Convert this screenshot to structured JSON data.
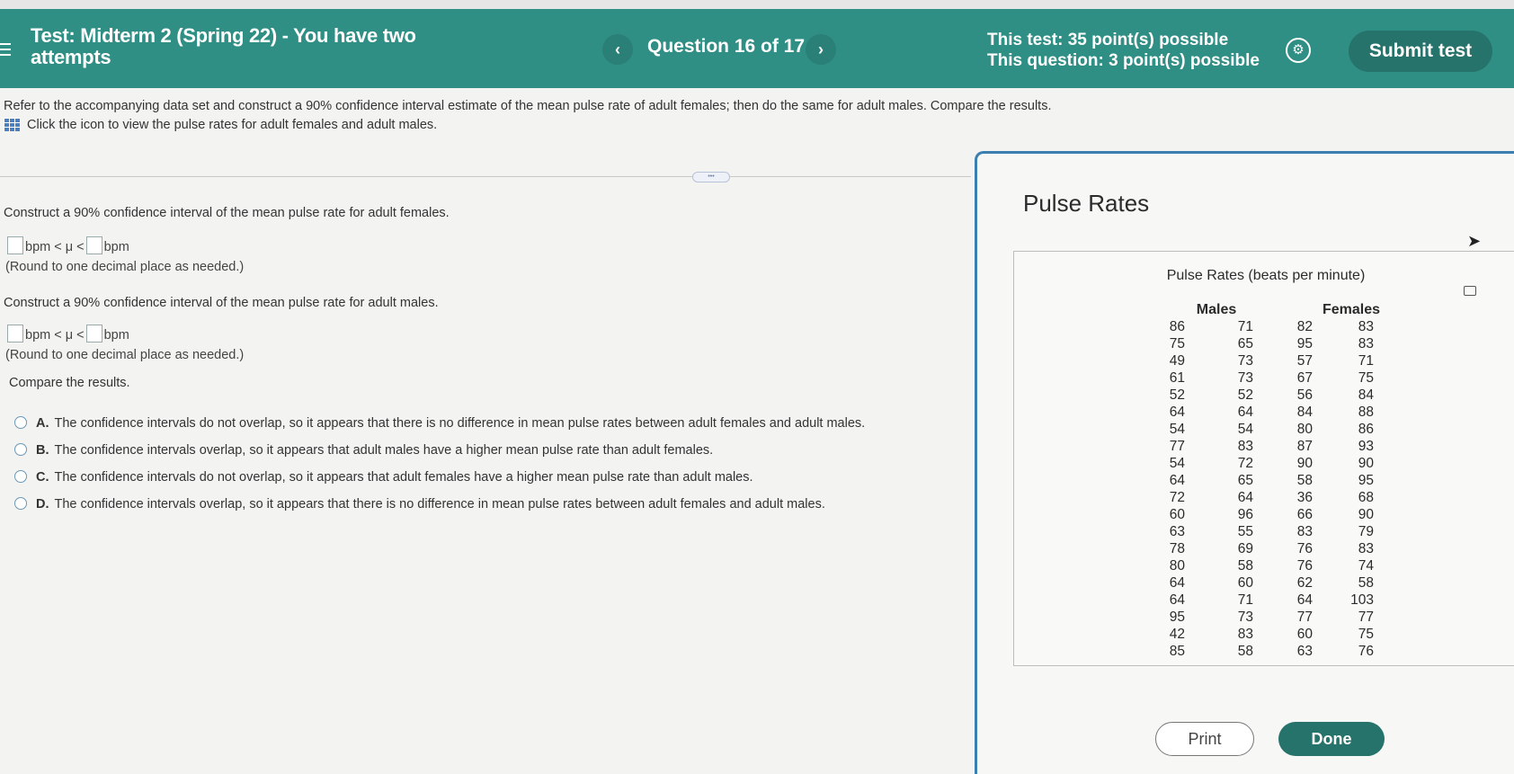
{
  "header": {
    "title": "Test: Midterm 2 (Spring 22) - You have two attempts",
    "question_counter": "Question 16 of 17",
    "prev_symbol": "‹",
    "next_symbol": "›",
    "test_points": "This test: 35 point(s) possible",
    "question_points": "This question: 3 point(s) possible",
    "submit_label": "Submit test"
  },
  "question": {
    "prompt": "Refer to the accompanying data set and construct a 90% confidence interval estimate of the mean pulse rate of adult females; then do the same for adult males. Compare the results.",
    "dataset_link": "Click the icon to view the pulse rates for adult females and adult males.",
    "part1": "Construct a 90% confidence interval of the mean pulse rate for adult females.",
    "part2": "Construct a 90% confidence interval of the mean pulse rate for adult males.",
    "ci_middle": "bpm < μ <",
    "ci_unit": "bpm",
    "round_note": "(Round to one decimal place as needed.)",
    "compare_label": "Compare the results.",
    "options": [
      {
        "letter": "A.",
        "text": "The confidence intervals do not overlap, so it appears that there is no difference in mean pulse rates between adult females and adult males."
      },
      {
        "letter": "B.",
        "text": "The confidence intervals overlap, so it appears that adult males have a higher mean pulse rate than adult females."
      },
      {
        "letter": "C.",
        "text": "The confidence intervals do not overlap, so it appears that adult females have a higher mean pulse rate than adult males."
      },
      {
        "letter": "D.",
        "text": "The confidence intervals overlap, so it appears that there is no difference in mean pulse rates between adult females and adult males."
      }
    ]
  },
  "panel": {
    "title": "Pulse Rates",
    "table_caption": "Pulse Rates (beats per minute)",
    "males_label": "Males",
    "females_label": "Females",
    "males_col1": [
      "86",
      "75",
      "49",
      "61",
      "52",
      "64",
      "54",
      "77",
      "54",
      "64",
      "72",
      "60",
      "63",
      "78",
      "80",
      "64",
      "64",
      "95",
      "42",
      "85"
    ],
    "males_col2": [
      "71",
      "65",
      "73",
      "73",
      "52",
      "64",
      "54",
      "83",
      "72",
      "65",
      "64",
      "96",
      "55",
      "69",
      "58",
      "60",
      "71",
      "73",
      "83",
      "58"
    ],
    "females_col1": [
      "82",
      "95",
      "57",
      "67",
      "56",
      "84",
      "80",
      "87",
      "90",
      "58",
      "36",
      "66",
      "83",
      "76",
      "76",
      "62",
      "64",
      "77",
      "60",
      "63"
    ],
    "females_col2": [
      "83",
      "83",
      "71",
      "75",
      "84",
      "88",
      "86",
      "93",
      "90",
      "95",
      "68",
      "90",
      "79",
      "83",
      "74",
      "58",
      "103",
      "77",
      "75",
      "76"
    ],
    "print_label": "Print",
    "done_label": "Done"
  }
}
